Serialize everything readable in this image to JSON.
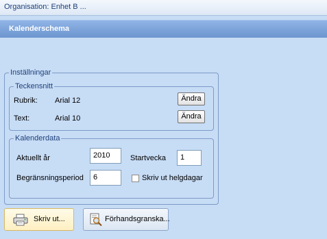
{
  "topbar": {
    "organisation": "Organisation: Enhet B  ..."
  },
  "header": {
    "title": "Kalenderschema"
  },
  "settings": {
    "legend": "Inställningar",
    "fonts": {
      "legend": "Teckensnitt",
      "heading_label": "Rubrik:",
      "heading_value": "Arial 12",
      "text_label": "Text:",
      "text_value": "Arial 10",
      "change_button": "Ändra"
    },
    "calendar": {
      "legend": "Kalenderdata",
      "year_label": "Aktuellt år",
      "year_value": "2010",
      "startweek_label": "Startvecka",
      "startweek_value": "1",
      "limit_label": "Begränsningsperiod",
      "limit_value": "6",
      "holidays_label": "Skriv ut helgdagar",
      "holidays_checked": false
    }
  },
  "actions": {
    "print_button": "Skriv ut...",
    "preview_button": "Förhandsgranska...",
    "icons": {
      "print": "printer-icon",
      "preview": "print-preview-icon"
    }
  },
  "colors": {
    "background": "#c7dcf5",
    "header": "#7ba1d9",
    "border": "#7d9bc7"
  }
}
